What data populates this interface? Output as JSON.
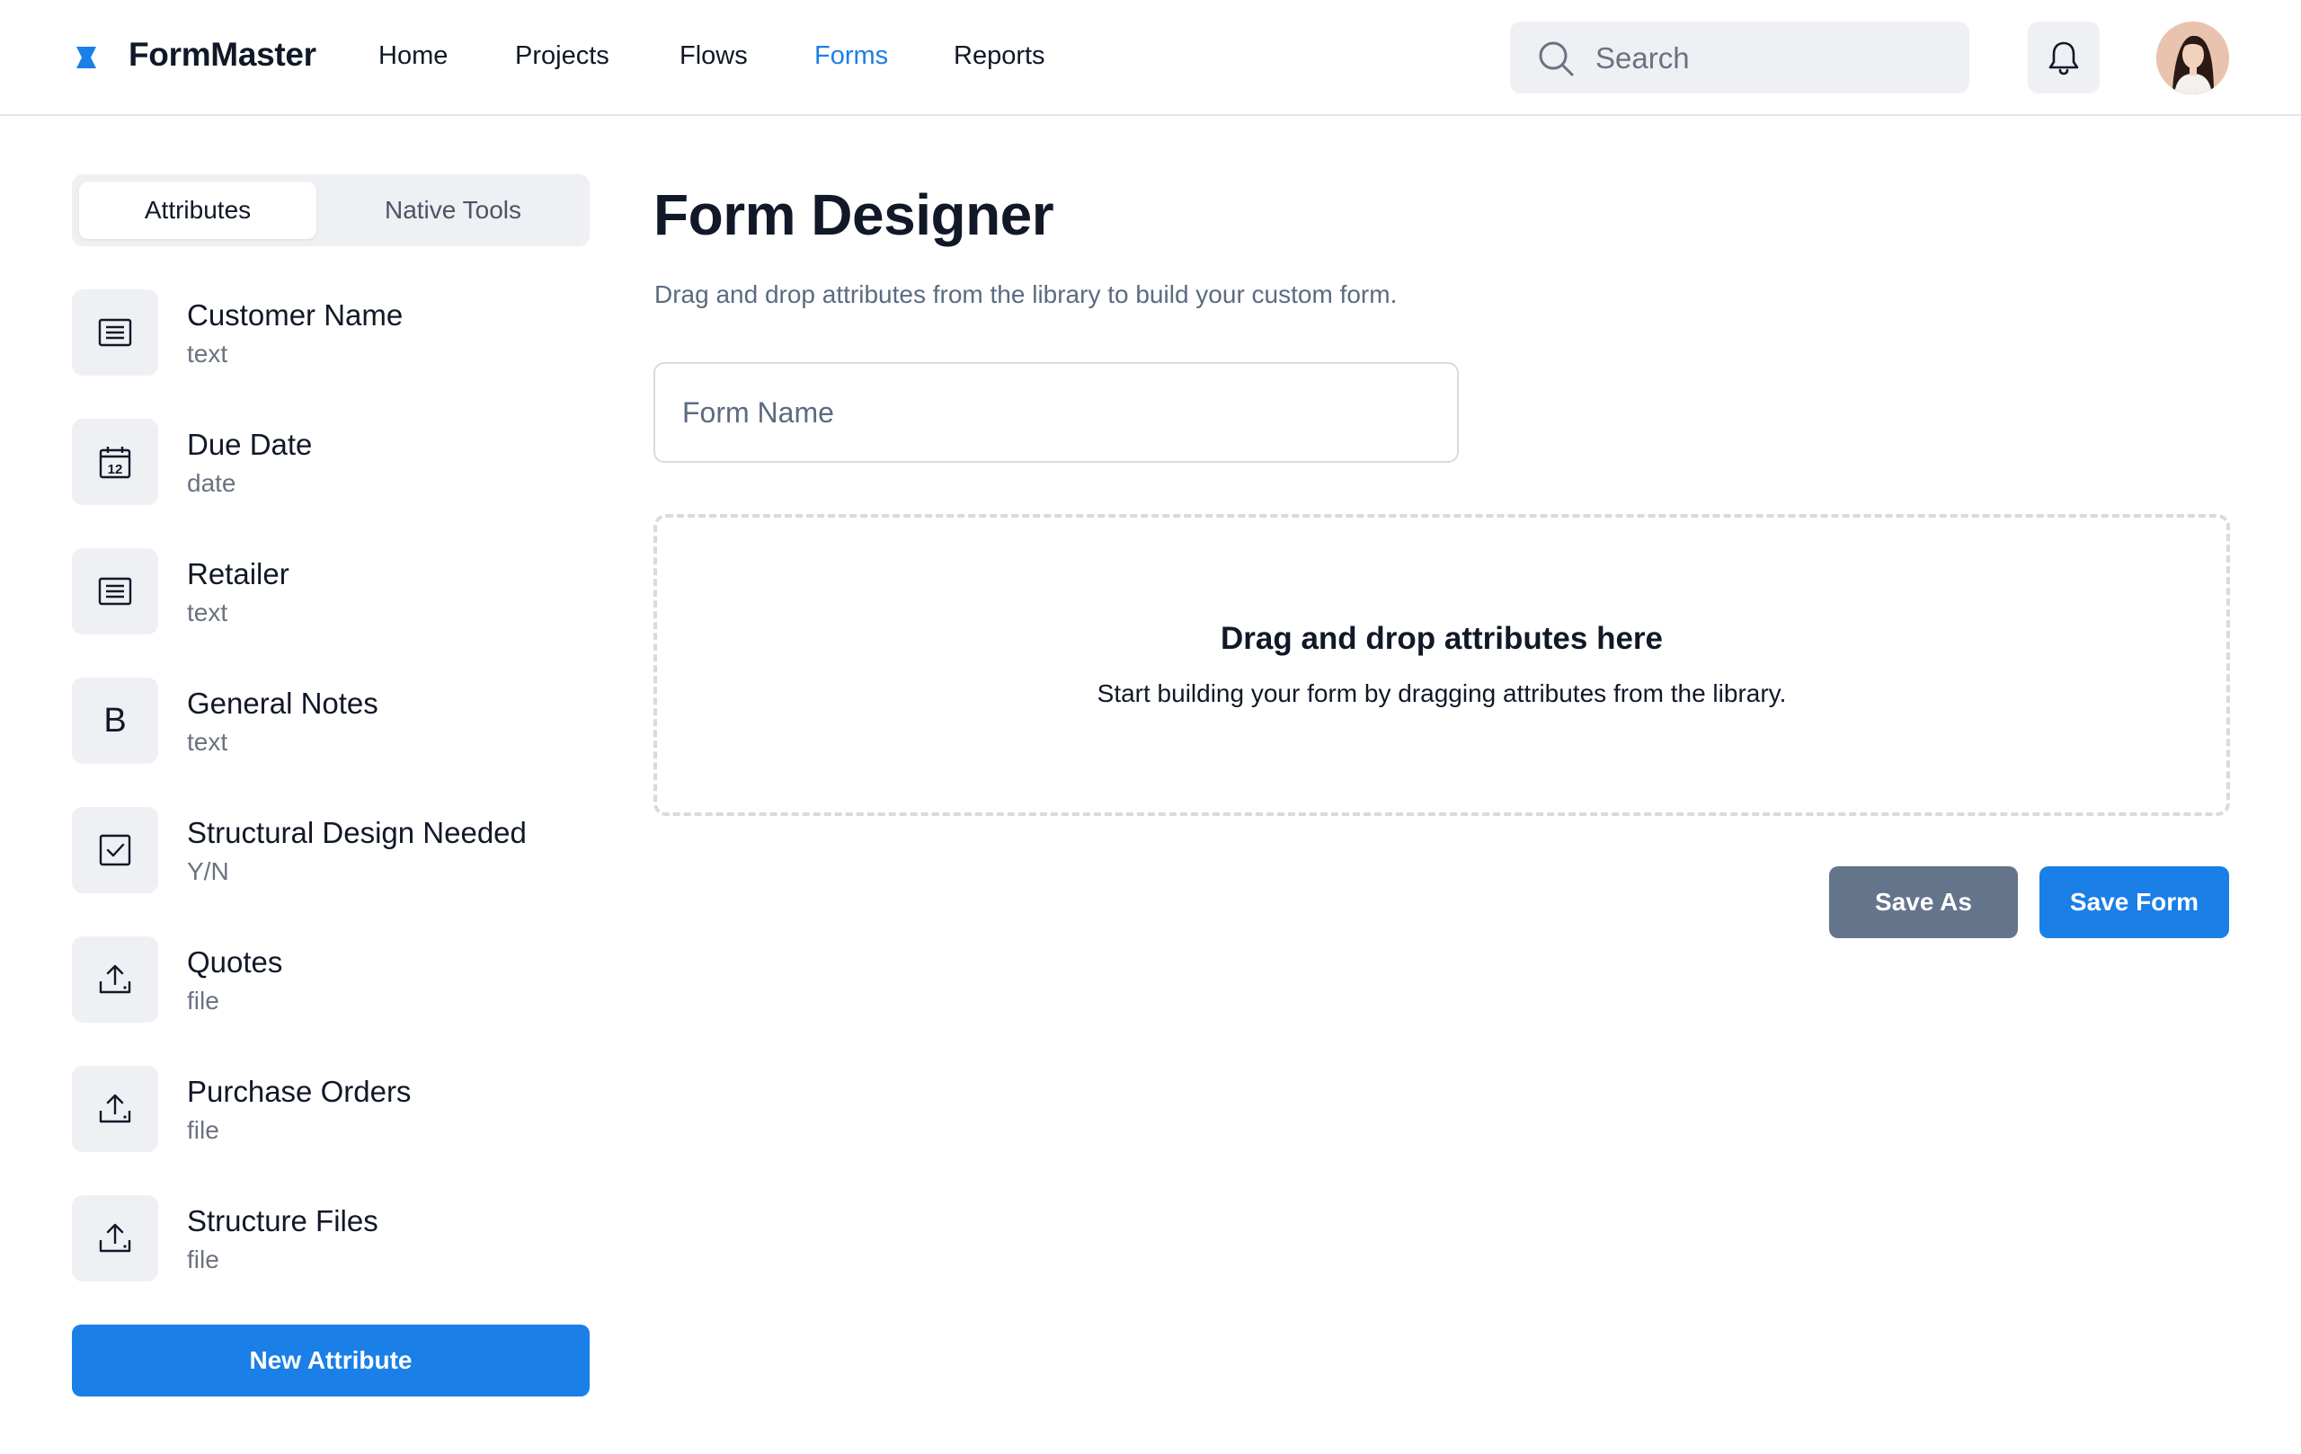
{
  "brand": {
    "name": "FormMaster",
    "accent": "#1a7fe6"
  },
  "nav": {
    "items": [
      {
        "label": "Home",
        "active": false
      },
      {
        "label": "Projects",
        "active": false
      },
      {
        "label": "Flows",
        "active": false
      },
      {
        "label": "Forms",
        "active": true
      },
      {
        "label": "Reports",
        "active": false
      }
    ]
  },
  "search": {
    "placeholder": "Search",
    "icon": "search-icon"
  },
  "header_icons": {
    "notifications": "bell-icon",
    "user": "avatar"
  },
  "sidebar": {
    "tabs": [
      {
        "label": "Attributes",
        "selected": true
      },
      {
        "label": "Native Tools",
        "selected": false
      }
    ],
    "attributes": [
      {
        "name": "Customer Name",
        "type": "text",
        "icon": "text-lines-icon"
      },
      {
        "name": "Due Date",
        "type": "date",
        "icon": "calendar-icon"
      },
      {
        "name": "Retailer",
        "type": "text",
        "icon": "text-lines-icon"
      },
      {
        "name": "General Notes",
        "type": "text",
        "icon": "bold-b-icon",
        "glyph": "B"
      },
      {
        "name": "Structural Design Needed",
        "type": "Y/N",
        "icon": "checkbox-icon"
      },
      {
        "name": "Quotes",
        "type": "file",
        "icon": "upload-icon"
      },
      {
        "name": "Purchase Orders",
        "type": "file",
        "icon": "upload-icon"
      },
      {
        "name": "Structure Files",
        "type": "file",
        "icon": "upload-icon"
      }
    ],
    "calendar_day": "12",
    "new_button": "New Attribute"
  },
  "main": {
    "title": "Form Designer",
    "subtitle": "Drag and drop attributes from the library to build your custom form.",
    "form_name": {
      "value": "",
      "placeholder": "Form Name"
    },
    "dropzone": {
      "title": "Drag and drop attributes here",
      "subtitle": "Start building your form by dragging attributes from the library."
    },
    "buttons": {
      "save_as": "Save As",
      "save_form": "Save Form"
    }
  },
  "colors": {
    "primary": "#1a7fe6",
    "secondary": "#64748b",
    "muted_bg": "#eef0f4"
  }
}
